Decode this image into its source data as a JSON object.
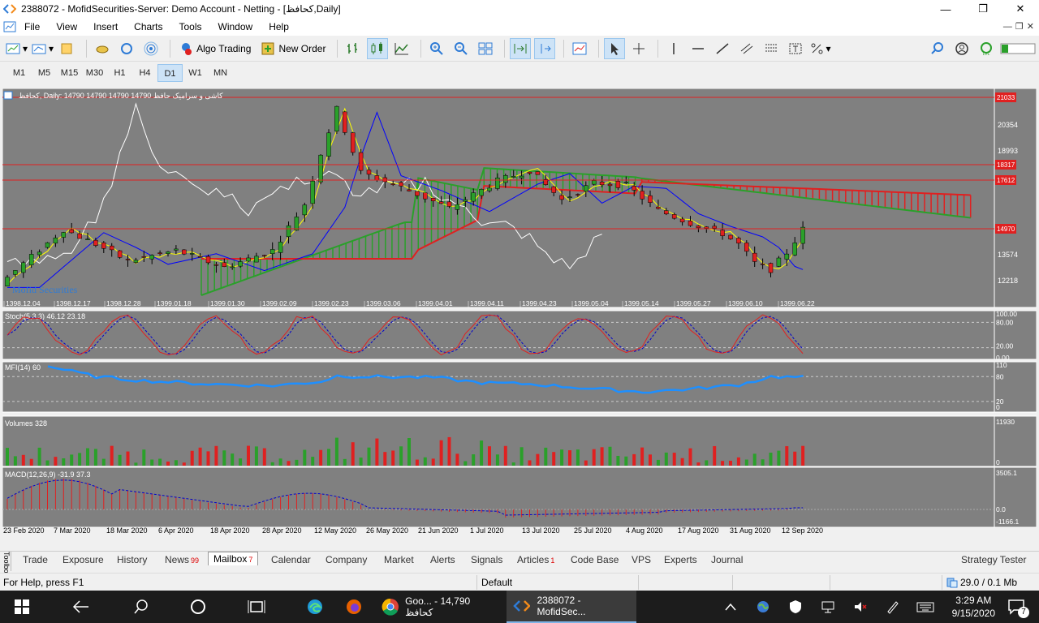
{
  "window": {
    "title": "2388072 - MofidSecurities-Server: Demo Account - Netting - [کحافظ,Daily]",
    "controls": [
      "—",
      "❐",
      "✕"
    ]
  },
  "menu": [
    "File",
    "View",
    "Insert",
    "Charts",
    "Tools",
    "Window",
    "Help"
  ],
  "toolbar": {
    "algo_trading": "Algo Trading",
    "new_order": "New Order"
  },
  "timeframes": [
    "M1",
    "M5",
    "M15",
    "M30",
    "H1",
    "H4",
    "D1",
    "W1",
    "MN"
  ],
  "timeframe_selected": "D1",
  "chart": {
    "header": "کحافظ, Daily:  14790 14790 14790 14790   کاشی و سرامیک حافظ",
    "watermark": "Mofid Securities",
    "price_labels": [
      "21033",
      "20354",
      "18993",
      "18317",
      "17612",
      "14970",
      "13574",
      "12218"
    ],
    "price_highlight": [
      "21033",
      "18317",
      "17612",
      "14970"
    ],
    "main_dates": [
      "1398.12.04",
      "1398.12.17",
      "1398.12.28",
      "1399.01.18",
      "1399.01.30",
      "1399.02.09",
      "1399.02.23",
      "1399.03.06",
      "1399.04.01",
      "1399.04.11",
      "1399.04.23",
      "1399.05.04",
      "1399.05.14",
      "1399.05.27",
      "1399.06.10",
      "1399.06.22"
    ],
    "bottom_dates": [
      "23 Feb 2020",
      "7 Mar 2020",
      "18 Mar 2020",
      "6 Apr 2020",
      "18 Apr 2020",
      "28 Apr 2020",
      "12 May 2020",
      "26 May 2020",
      "21 Jun 2020",
      "1 Jul 2020",
      "13 Jul 2020",
      "25 Jul 2020",
      "4 Aug 2020",
      "17 Aug 2020",
      "31 Aug 2020",
      "12 Sep 2020"
    ],
    "stoch": {
      "label": "Stoch(5,3,3) 46.12 23.18",
      "levels": [
        "100.00",
        "80.00",
        "20.00",
        "0.00"
      ]
    },
    "mfi": {
      "label": "MFI(14) 60",
      "levels": [
        "110",
        "80",
        "20",
        "0"
      ]
    },
    "volumes": {
      "label": "Volumes 328",
      "levels": [
        "11930",
        "0"
      ]
    },
    "macd": {
      "label": "MACD(12,26,9) -31.9 37.3",
      "levels": [
        "3505.1",
        "0.0",
        "-1166.1"
      ]
    }
  },
  "tabs": [
    {
      "label": "Trade"
    },
    {
      "label": "Exposure"
    },
    {
      "label": "History"
    },
    {
      "label": "News",
      "badge": "99"
    },
    {
      "label": "Mailbox",
      "badge": "7"
    },
    {
      "label": "Calendar"
    },
    {
      "label": "Company"
    },
    {
      "label": "Market"
    },
    {
      "label": "Alerts"
    },
    {
      "label": "Signals"
    },
    {
      "label": "Articles",
      "badge": "1"
    },
    {
      "label": "Code Base"
    },
    {
      "label": "VPS"
    },
    {
      "label": "Experts"
    },
    {
      "label": "Journal"
    }
  ],
  "tabs_active": "Mailbox",
  "toolbox_label": "Toolbox",
  "strategy_tester": "Strategy Tester",
  "status": {
    "help": "For Help, press F1",
    "profile": "Default",
    "traffic": "29.0 / 0.1 Mb"
  },
  "taskbar": {
    "apps": [
      {
        "label": "Goo... - 14,790 کحافظ",
        "icon": "chrome-icon"
      },
      {
        "label": "2388072 - MofidSec...",
        "icon": "metatrader-icon"
      }
    ],
    "time": "3:29 AM",
    "date": "9/15/2020",
    "notifications": "7"
  },
  "colors": {
    "chart_bg": "#808080",
    "bull": "#2aa02a",
    "bear": "#e02020",
    "tenkan": "#ffff00",
    "kijun": "#0000ff",
    "chikou": "#ffffff"
  }
}
